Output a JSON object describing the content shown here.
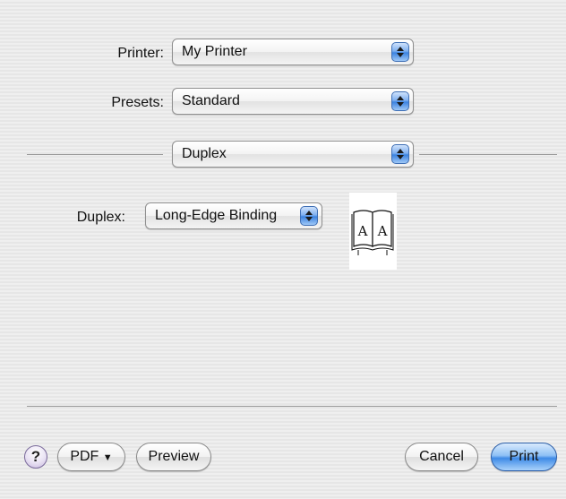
{
  "printer": {
    "label": "Printer:",
    "value": "My Printer"
  },
  "presets": {
    "label": "Presets:",
    "value": "Standard"
  },
  "panel": {
    "value": "Duplex"
  },
  "duplex": {
    "label": "Duplex:",
    "value": "Long-Edge Binding",
    "preview_letters": [
      "A",
      "A"
    ]
  },
  "buttons": {
    "help": "?",
    "pdf": "PDF",
    "pdf_arrow": "▼",
    "preview": "Preview",
    "cancel": "Cancel",
    "print": "Print"
  },
  "icons": {
    "popup_arrows": "up-down-arrows-icon",
    "duplex_preview": "open-book-icon",
    "help": "question-mark-icon",
    "pdf_menu": "triangle-down-icon"
  }
}
